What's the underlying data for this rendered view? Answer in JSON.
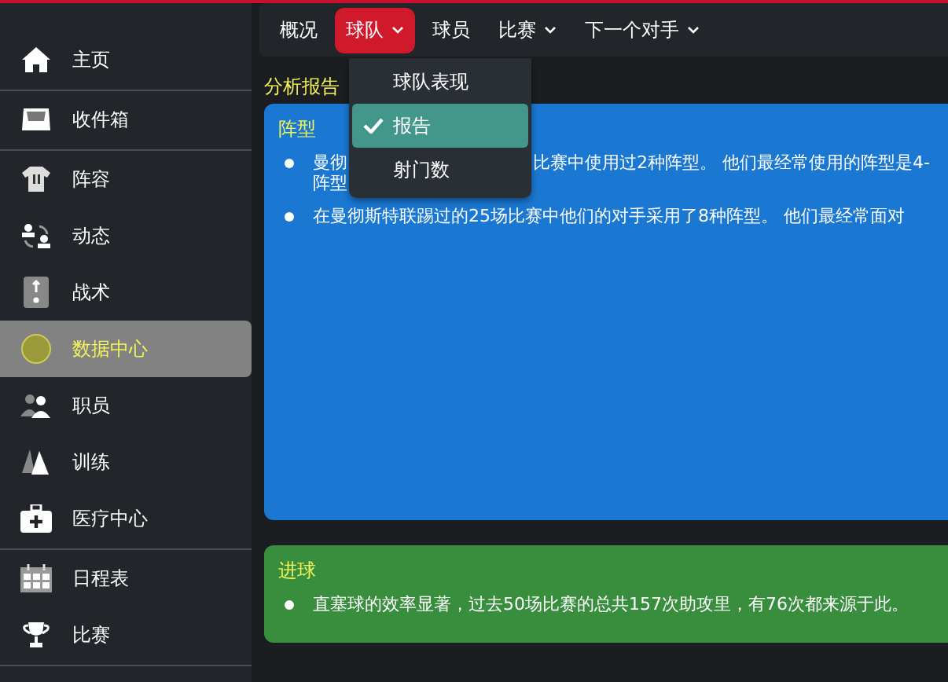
{
  "sidebar": {
    "groups": [
      {
        "items": [
          {
            "label": "主页",
            "selected": false
          }
        ]
      },
      {
        "items": [
          {
            "label": "收件箱",
            "selected": false
          }
        ]
      },
      {
        "items": [
          {
            "label": "阵容",
            "selected": false
          },
          {
            "label": "动态",
            "selected": false
          },
          {
            "label": "战术",
            "selected": false
          },
          {
            "label": "数据中心",
            "selected": true
          },
          {
            "label": "职员",
            "selected": false
          },
          {
            "label": "训练",
            "selected": false
          },
          {
            "label": "医疗中心",
            "selected": false
          }
        ]
      },
      {
        "items": [
          {
            "label": "日程表",
            "selected": false
          },
          {
            "label": "比赛",
            "selected": false
          }
        ]
      }
    ]
  },
  "nav_tabs": [
    {
      "label": "概况",
      "selected": false,
      "has_menu": false
    },
    {
      "label": "球队",
      "selected": true,
      "has_menu": true
    },
    {
      "label": "球员",
      "selected": false,
      "has_menu": false
    },
    {
      "label": "比赛",
      "selected": false,
      "has_menu": true
    },
    {
      "label": "下一个对手",
      "selected": false,
      "has_menu": true
    }
  ],
  "dropdown": {
    "items": [
      {
        "label": "球队表现",
        "selected": false
      },
      {
        "label": "报告",
        "selected": true
      },
      {
        "label": "射门数",
        "selected": false
      }
    ]
  },
  "page_title": "分析报告",
  "sections": [
    {
      "title": "阵型",
      "color": "#1a78d2",
      "bullets": [
        {
          "parts": [
            "曼彻",
            "比赛中使用过2种阵型。 他们最经常使用的阵型是4-",
            "阵型"
          ]
        },
        {
          "parts": [
            "在曼彻斯特联踢过的25场比赛中他们的对手采用了8种阵型。 他们最经常面对"
          ]
        }
      ]
    },
    {
      "title": "进球",
      "color": "#388e3c",
      "bullets": [
        {
          "parts": [
            "直塞球的效率显著，过去50场比赛的总共157次助攻里，有76次都来源于此。"
          ]
        }
      ]
    }
  ]
}
